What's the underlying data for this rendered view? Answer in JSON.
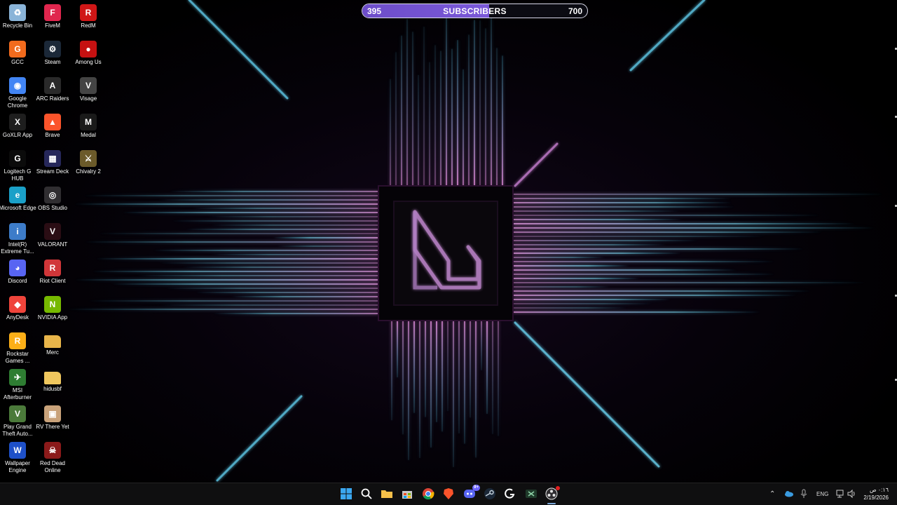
{
  "subscriber_bar": {
    "current": "395",
    "label": "SUBSCRIBERS",
    "goal": "700",
    "progress_fraction": 0.5643
  },
  "desktop": {
    "icons": [
      {
        "name": "recycle-bin",
        "label": "Recycle Bin",
        "icon": "recycle-bin-icon",
        "color": "#8ab4d8"
      },
      {
        "name": "fivem",
        "label": "FiveM",
        "icon": "fivem-icon",
        "color": "#e0264e"
      },
      {
        "name": "redm",
        "label": "RedM",
        "icon": "redm-icon",
        "color": "#d01616"
      },
      {
        "name": "gcc",
        "label": "GCC",
        "icon": "gcc-icon",
        "color": "#f26b1d"
      },
      {
        "name": "steam",
        "label": "Steam",
        "icon": "steam-icon",
        "color": "#1b2838"
      },
      {
        "name": "among-us",
        "label": "Among Us",
        "icon": "among-us-icon",
        "color": "#c51111"
      },
      {
        "name": "google-chrome",
        "label": "Google Chrome",
        "icon": "chrome-icon",
        "color": "#4285f4"
      },
      {
        "name": "arc-raiders",
        "label": "ARC Raiders",
        "icon": "arc-raiders-icon",
        "color": "#2a2a2a"
      },
      {
        "name": "visage",
        "label": "Visage",
        "icon": "visage-icon",
        "color": "#444444"
      },
      {
        "name": "goxlr-app",
        "label": "GoXLR App",
        "icon": "goxlr-icon",
        "color": "#1e1e1e"
      },
      {
        "name": "brave",
        "label": "Brave",
        "icon": "brave-icon",
        "color": "#fb542b"
      },
      {
        "name": "medal",
        "label": "Medal",
        "icon": "medal-icon",
        "color": "#1a1a1a"
      },
      {
        "name": "logitech-g-hub",
        "label": "Logitech G HUB",
        "icon": "logitech-icon",
        "color": "#0b0b0b"
      },
      {
        "name": "stream-deck",
        "label": "Stream Deck",
        "icon": "stream-deck-icon",
        "color": "#26275a"
      },
      {
        "name": "chivalry-2",
        "label": "Chivalry 2",
        "icon": "chivalry-icon",
        "color": "#6b5a2a"
      },
      {
        "name": "microsoft-edge",
        "label": "Microsoft Edge",
        "icon": "edge-icon",
        "color": "#1aa0c8"
      },
      {
        "name": "obs-studio",
        "label": "OBS Studio",
        "icon": "obs-icon",
        "color": "#302e31"
      },
      {
        "name": "intel-extreme-tuning",
        "label": "Intel(R) Extreme Tu...",
        "icon": "intel-icon",
        "color": "#3d7cc9"
      },
      {
        "name": "valorant",
        "label": "VALORANT",
        "icon": "valorant-icon",
        "color": "#2a0d14"
      },
      {
        "name": "discord",
        "label": "Discord",
        "icon": "discord-icon",
        "color": "#5865f2"
      },
      {
        "name": "riot-client",
        "label": "Riot Client",
        "icon": "riot-icon",
        "color": "#d13639"
      },
      {
        "name": "anydesk",
        "label": "AnyDesk",
        "icon": "anydesk-icon",
        "color": "#ef443b"
      },
      {
        "name": "nvidia-app",
        "label": "NVIDIA App",
        "icon": "nvidia-icon",
        "color": "#76b900"
      },
      {
        "name": "rockstar-games",
        "label": "Rockstar Games ...",
        "icon": "rockstar-icon",
        "color": "#fcaf17"
      },
      {
        "name": "merc",
        "label": "Merc",
        "icon": "folder-icon",
        "color": "#e8b54a"
      },
      {
        "name": "msi-afterburner",
        "label": "MSI Afterburner",
        "icon": "afterburner-icon",
        "color": "#2e7d32"
      },
      {
        "name": "hidusbf",
        "label": "hidusbf",
        "icon": "folder-icon",
        "color": "#f0c75e"
      },
      {
        "name": "play-gta",
        "label": "Play Grand Theft Auto...",
        "icon": "gta-icon",
        "color": "#4b7a3a"
      },
      {
        "name": "rv-there-yet",
        "label": "RV There Yet",
        "icon": "rv-icon",
        "color": "#c9a27a"
      },
      {
        "name": "wallpaper-engine",
        "label": "Wallpaper Engine",
        "icon": "wallpaper-engine-icon",
        "color": "#1e50c8"
      },
      {
        "name": "red-dead-online",
        "label": "Red Dead Online",
        "icon": "rdo-icon",
        "color": "#8b1a1a"
      }
    ]
  },
  "taskbar": {
    "apps": [
      {
        "name": "start",
        "icon": "windows-start-icon",
        "color": "#3ba7f0"
      },
      {
        "name": "search",
        "icon": "search-icon",
        "color": "#ffffff"
      },
      {
        "name": "file-explorer",
        "icon": "folder-icon",
        "color": "#f5c04a"
      },
      {
        "name": "microsoft-store",
        "icon": "store-icon",
        "color": "#c8c8c8"
      },
      {
        "name": "chrome",
        "icon": "chrome-icon",
        "color": "#4285f4"
      },
      {
        "name": "brave",
        "icon": "brave-icon",
        "color": "#fb542b"
      },
      {
        "name": "discord",
        "icon": "discord-icon",
        "color": "#5865f2",
        "badge": "9+"
      },
      {
        "name": "steam",
        "icon": "steam-icon",
        "color": "#c7d5e0"
      },
      {
        "name": "logitech-g-hub",
        "icon": "logitech-icon",
        "color": "#ffffff"
      },
      {
        "name": "goxlr",
        "icon": "goxlr-icon",
        "color": "#8fd3a8"
      },
      {
        "name": "obs",
        "icon": "obs-icon",
        "color": "#e6e6e6"
      }
    ],
    "tray": {
      "language": "ENG",
      "time": "٠:١٦ ص",
      "date": "2/19/2026"
    }
  }
}
